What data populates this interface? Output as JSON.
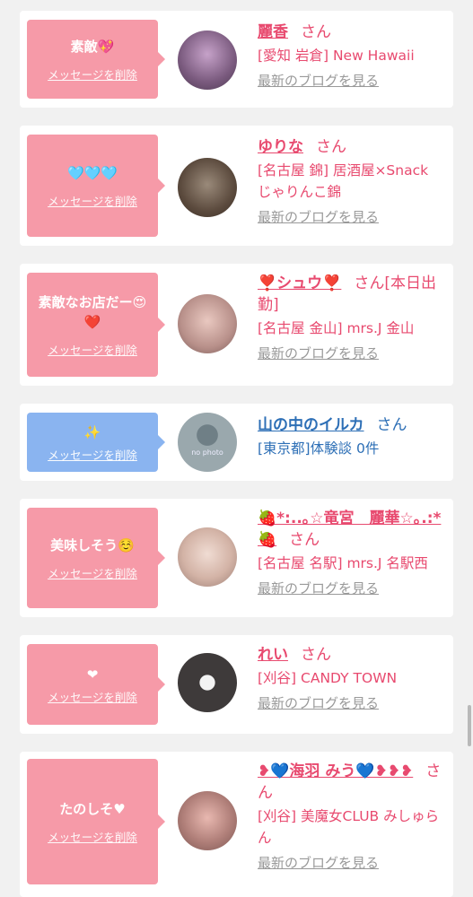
{
  "colors": {
    "pink_bubble": "#f69aa8",
    "blue_bubble": "#8ab4f0",
    "name_pink": "#e84a6f",
    "name_blue": "#2d6fb6",
    "muted": "#999999"
  },
  "delete_label": "メッセージを削除",
  "blog_label": "最新のブログを見る",
  "honorific": "さん",
  "cards": [
    {
      "message": "素敵💖",
      "name": "麗香",
      "shop": "[愛知 岩倉] New Hawaii",
      "has_blog": true,
      "style": "pink"
    },
    {
      "message": "🩵🩵🩵",
      "name": "ゆりな",
      "shop": "[名古屋 錦] 居酒屋×Snack じゃりんこ錦",
      "has_blog": true,
      "style": "pink"
    },
    {
      "message": "素敵なお店だー😍❤️",
      "name": "❣️シュウ❣️",
      "name_suffix": "さん[本日出勤]",
      "shop": "[名古屋 金山] mrs.J 金山",
      "has_blog": true,
      "style": "pink"
    },
    {
      "message": "✨",
      "name": "山の中のイルカ",
      "shop": "[東京都]体験談 0件",
      "has_blog": false,
      "style": "blue",
      "avatar_label": "no photo"
    },
    {
      "message": "美味しそう☺️",
      "name": "🍓*:..｡☆竜宮　麗華☆｡.:*🍓",
      "shop": "[名古屋 名駅] mrs.J 名駅西",
      "has_blog": true,
      "style": "pink"
    },
    {
      "message": "❤︎",
      "name": "れい",
      "shop": "[刈谷] CANDY TOWN",
      "has_blog": true,
      "style": "pink"
    },
    {
      "message": "たのしそ♥",
      "name": "❥💙海羽 みう💙❥❥❥",
      "shop": "[刈谷] 美魔女CLUB みしゅらん",
      "has_blog": true,
      "style": "pink"
    }
  ]
}
